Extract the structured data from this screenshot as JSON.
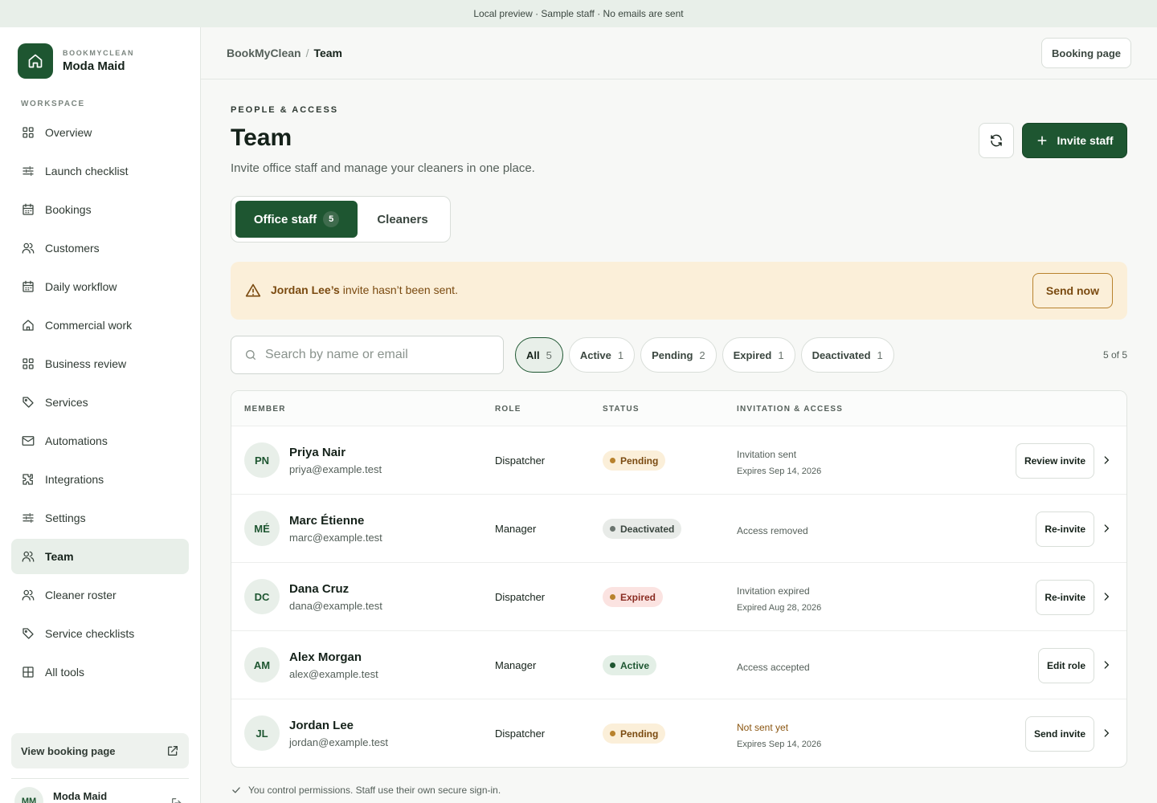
{
  "banner": {
    "text": "Local preview · Sample staff · No emails are sent"
  },
  "brand": {
    "kicker": "BOOKMYCLEAN",
    "name": "Moda Maid",
    "icon": "home-icon"
  },
  "sidebar": {
    "section_label": "WORKSPACE",
    "items": [
      {
        "label": "Overview",
        "icon": "grid-icon"
      },
      {
        "label": "Launch checklist",
        "icon": "sliders-icon"
      },
      {
        "label": "Bookings",
        "icon": "calendar-icon"
      },
      {
        "label": "Customers",
        "icon": "users-icon"
      },
      {
        "label": "Daily workflow",
        "icon": "calendar-icon"
      },
      {
        "label": "Commercial work",
        "icon": "home-icon"
      },
      {
        "label": "Business review",
        "icon": "grid-icon"
      },
      {
        "label": "Services",
        "icon": "tag-icon"
      },
      {
        "label": "Automations",
        "icon": "mail-icon"
      },
      {
        "label": "Integrations",
        "icon": "puzzle-icon"
      },
      {
        "label": "Settings",
        "icon": "sliders-icon"
      },
      {
        "label": "Team",
        "icon": "users-icon",
        "active": true
      },
      {
        "label": "Cleaner roster",
        "icon": "users-icon"
      },
      {
        "label": "Service checklists",
        "icon": "tag-icon"
      },
      {
        "label": "All tools",
        "icon": "table-icon"
      }
    ],
    "view_booking_label": "View booking page",
    "user": {
      "initials": "MM",
      "name": "Moda Maid"
    }
  },
  "header": {
    "breadcrumb_root": "BookMyClean",
    "breadcrumb_sep": "/",
    "breadcrumb_current": "Team",
    "booking_page_label": "Booking page"
  },
  "page": {
    "kicker": "PEOPLE & ACCESS",
    "title": "Team",
    "subtitle": "Invite office staff and manage your cleaners in one place.",
    "invite_label": "Invite staff"
  },
  "tabs": {
    "office_label": "Office staff",
    "office_count": "5",
    "cleaners_label": "Cleaners"
  },
  "alert": {
    "name": "Jordan Lee’s",
    "message": " invite hasn’t been sent.",
    "action": "Send now"
  },
  "search": {
    "placeholder": "Search by name or email"
  },
  "filters": [
    {
      "label": "All",
      "count": "5",
      "active": true
    },
    {
      "label": "Active",
      "count": "1"
    },
    {
      "label": "Pending",
      "count": "2"
    },
    {
      "label": "Expired",
      "count": "1"
    },
    {
      "label": "Deactivated",
      "count": "1"
    }
  ],
  "result_count": "5 of 5",
  "table": {
    "headers": {
      "member": "MEMBER",
      "role": "ROLE",
      "status": "STATUS",
      "invitation": "INVITATION & ACCESS"
    },
    "rows": [
      {
        "initials": "PN",
        "name": "Priya Nair",
        "email": "priya@example.test",
        "role": "Dispatcher",
        "status": "Pending",
        "status_kind": "pending",
        "inv_line1": "Invitation sent",
        "inv_line2": "Expires Sep 14, 2026",
        "action": "Review invite"
      },
      {
        "initials": "MÉ",
        "name": "Marc Étienne",
        "email": "marc@example.test",
        "role": "Manager",
        "status": "Deactivated",
        "status_kind": "deact",
        "inv_line1": "Access removed",
        "inv_line2": "",
        "action": "Re-invite"
      },
      {
        "initials": "DC",
        "name": "Dana Cruz",
        "email": "dana@example.test",
        "role": "Dispatcher",
        "status": "Expired",
        "status_kind": "expired",
        "inv_line1": "Invitation expired",
        "inv_line2": "Expired Aug 28, 2026",
        "action": "Re-invite"
      },
      {
        "initials": "AM",
        "name": "Alex Morgan",
        "email": "alex@example.test",
        "role": "Manager",
        "status": "Active",
        "status_kind": "active",
        "inv_line1": "Access accepted",
        "inv_line2": "",
        "action": "Edit role"
      },
      {
        "initials": "JL",
        "name": "Jordan Lee",
        "email": "jordan@example.test",
        "role": "Dispatcher",
        "status": "Pending",
        "status_kind": "pending",
        "inv_line1": "Not sent yet",
        "inv_line2": "Expires Sep 14, 2026",
        "action": "Send invite",
        "warn": true
      }
    ]
  },
  "footnote": "You control permissions. Staff use their own secure sign-in."
}
